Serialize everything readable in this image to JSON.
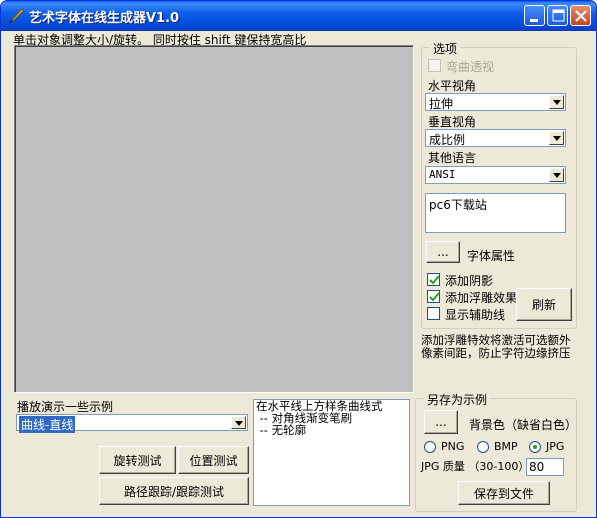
{
  "window": {
    "title": "艺术字体在线生成器V1.0",
    "accent": "#0A5CF0"
  },
  "hint": "单击对象调整大小/旋转。 同时按住 shift 键保持宽高比",
  "options": {
    "group_title": "选项",
    "curve_perspective_label": "弯曲透视",
    "curve_perspective_checked": false,
    "horizontal_label": "水平视角",
    "horizontal_value": "拉伸",
    "vertical_label": "垂直视角",
    "vertical_value": "成比例",
    "language_label": "其他语言",
    "language_value": "ANSI",
    "text_value": "pc6下载站",
    "font_button": "...",
    "font_label": "字体属性",
    "shadow_label": "添加阴影",
    "shadow_checked": true,
    "emboss_label": "添加浮雕效果",
    "emboss_checked": true,
    "guides_label": "显示辅助线",
    "guides_checked": false,
    "refresh_button": "刷新",
    "note": "添加浮雕特效将激活可选额外像素间距，防止字符边缘挤压"
  },
  "demo": {
    "label": "播放演示一些示例",
    "selected": "曲线-直线",
    "description": [
      "在水平线上方样条曲线式",
      " -- 对角线渐变笔刷",
      " -- 无轮廓"
    ],
    "rotate_button": "旋转测试",
    "position_button": "位置测试",
    "path_button": "路径跟踪/跟踪测试"
  },
  "save": {
    "group_title": "另存为示例",
    "bg_button": "...",
    "bg_label": "背景色（缺省白色）",
    "formats": [
      {
        "label": "PNG",
        "selected": false
      },
      {
        "label": "BMP",
        "selected": false
      },
      {
        "label": "JPG",
        "selected": true
      }
    ],
    "quality_label": "JPG 质量 （30-100）",
    "quality_value": "80",
    "save_button": "保存到文件"
  }
}
